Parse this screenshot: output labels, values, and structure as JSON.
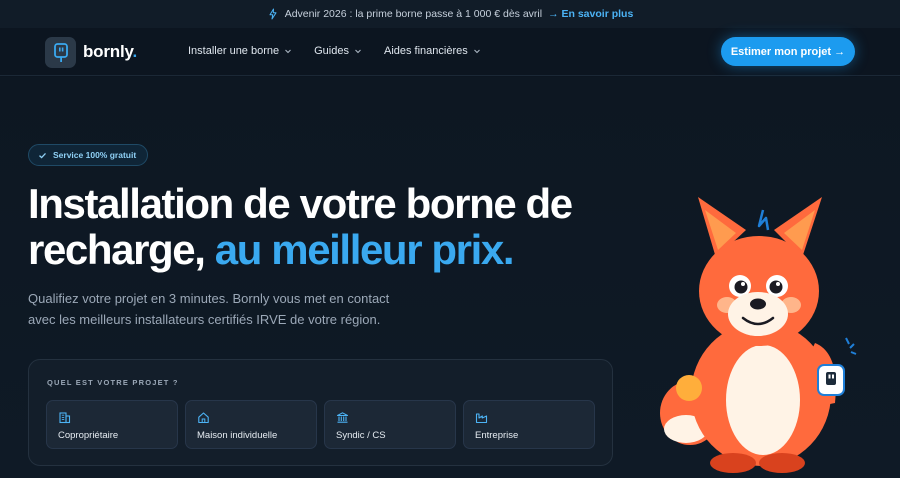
{
  "announcement": {
    "text": "Advenir 2026 : la prime borne passe à 1 000 € dès avril",
    "link_label": "→ En savoir plus"
  },
  "nav": {
    "brand": "bornly",
    "brand_dot": ".",
    "menu": [
      {
        "label": "Installer une borne"
      },
      {
        "label": "Guides"
      },
      {
        "label": "Aides financières"
      }
    ],
    "cta_label": "Estimer mon projet →"
  },
  "hero": {
    "badge": "Service 100% gratuit",
    "title_line1": "Installation de votre borne de",
    "title_line2_plain": "recharge, ",
    "title_line2_accent": "au meilleur prix.",
    "subtitle_line1": "Qualifiez votre projet en 3 minutes. Bornly vous met en contact",
    "subtitle_line2": "avec les meilleurs installateurs certifiés IRVE de votre région."
  },
  "project_card": {
    "label": "QUEL EST VOTRE PROJET ?",
    "options": [
      {
        "label": "Copropriétaire",
        "icon": "building-icon"
      },
      {
        "label": "Maison individuelle",
        "icon": "house-icon"
      },
      {
        "label": "Syndic / CS",
        "icon": "bank-icon"
      },
      {
        "label": "Entreprise",
        "icon": "factory-icon"
      }
    ]
  },
  "colors": {
    "accent": "#3aa9f0",
    "cta": "#1c9bef",
    "background": "#0c1520",
    "mascot_orange": "#ff6a3d"
  }
}
